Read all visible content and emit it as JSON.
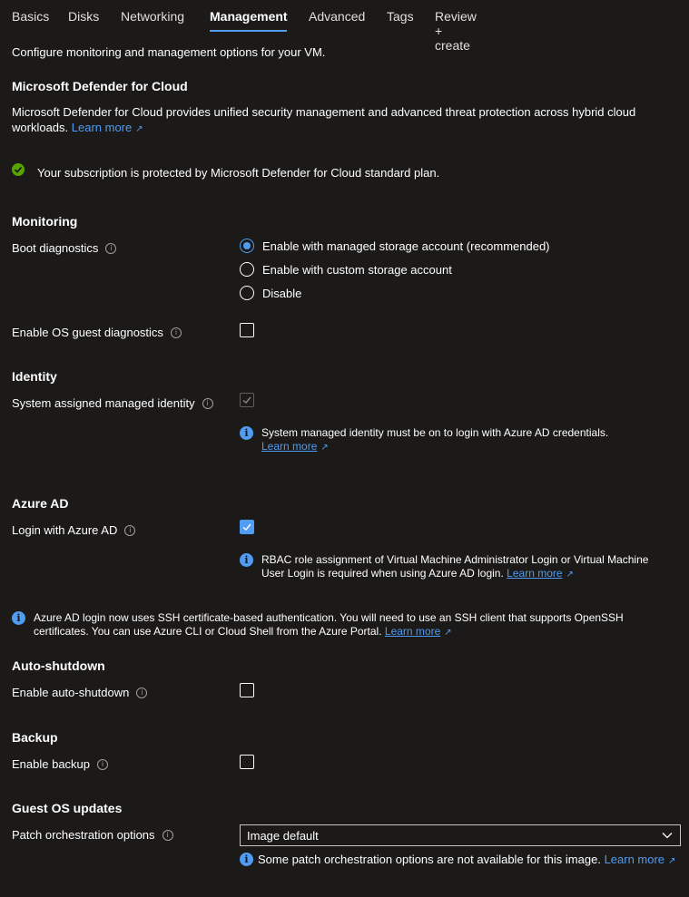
{
  "tabs": [
    {
      "label": "Basics"
    },
    {
      "label": "Disks"
    },
    {
      "label": "Networking"
    },
    {
      "label": "Management"
    },
    {
      "label": "Advanced"
    },
    {
      "label": "Tags"
    },
    {
      "label": "Review + create"
    }
  ],
  "active_tab": "Management",
  "intro": "Configure monitoring and management options for your VM.",
  "defender": {
    "title": "Microsoft Defender for Cloud",
    "description": "Microsoft Defender for Cloud provides unified security management and advanced threat protection across hybrid cloud workloads.",
    "learn_more": "Learn more",
    "status": "Your subscription is protected by Microsoft Defender for Cloud standard plan."
  },
  "monitoring": {
    "title": "Monitoring",
    "boot_diagnostics_label": "Boot diagnostics",
    "boot_options": [
      {
        "label": "Enable with managed storage account (recommended)",
        "selected": true
      },
      {
        "label": "Enable with custom storage account",
        "selected": false
      },
      {
        "label": "Disable",
        "selected": false
      }
    ],
    "os_guest_label": "Enable OS guest diagnostics",
    "os_guest_checked": false
  },
  "identity": {
    "title": "Identity",
    "system_identity_label": "System assigned managed identity",
    "system_identity_checked": true,
    "system_identity_disabled": true,
    "note": "System managed identity must be on to login with Azure AD credentials.",
    "learn_more": "Learn more"
  },
  "azure_ad": {
    "title": "Azure AD",
    "login_label": "Login with Azure AD",
    "login_checked": true,
    "note_line1": "RBAC role assignment of Virtual Machine Administrator Login or Virtual Machine",
    "note_line2": "User Login is required when using Azure AD login.",
    "learn_more": "Learn more",
    "ssh_note_line1": "Azure AD login now uses SSH certificate-based authentication. You will need to use an SSH client that supports OpenSSH",
    "ssh_note_line2": "certificates. You can use Azure CLI or Cloud Shell from the Azure Portal.",
    "ssh_learn_more": "Learn more"
  },
  "auto_shutdown": {
    "title": "Auto-shutdown",
    "label": "Enable auto-shutdown",
    "checked": false
  },
  "backup": {
    "title": "Backup",
    "label": "Enable backup",
    "checked": false
  },
  "guest_os": {
    "title": "Guest OS updates",
    "patch_label": "Patch orchestration options",
    "patch_value": "Image default",
    "note": "Some patch orchestration options are not available for this image.",
    "learn_more": "Learn more"
  },
  "colors": {
    "background": "#1b1a19",
    "accent": "#4f9cf2",
    "success": "#57a300"
  },
  "icons": {
    "info": "info-icon",
    "external": "external-link-icon",
    "success": "checkmark-circle-icon",
    "chevron": "chevron-down-icon"
  }
}
